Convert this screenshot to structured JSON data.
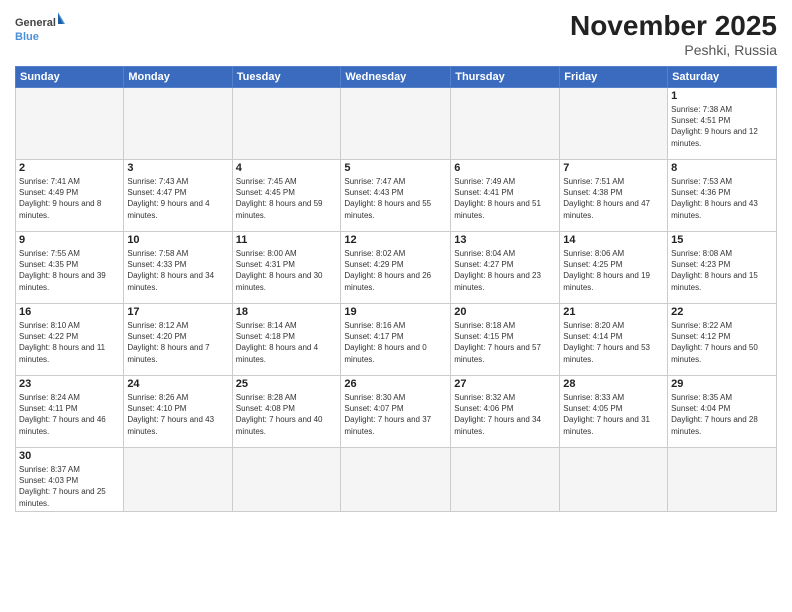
{
  "header": {
    "logo_general": "General",
    "logo_blue": "Blue",
    "month_title": "November 2025",
    "location": "Peshki, Russia"
  },
  "weekdays": [
    "Sunday",
    "Monday",
    "Tuesday",
    "Wednesday",
    "Thursday",
    "Friday",
    "Saturday"
  ],
  "weeks": [
    [
      {
        "day": "",
        "info": ""
      },
      {
        "day": "",
        "info": ""
      },
      {
        "day": "",
        "info": ""
      },
      {
        "day": "",
        "info": ""
      },
      {
        "day": "",
        "info": ""
      },
      {
        "day": "",
        "info": ""
      },
      {
        "day": "1",
        "info": "Sunrise: 7:38 AM\nSunset: 4:51 PM\nDaylight: 9 hours and 12 minutes."
      }
    ],
    [
      {
        "day": "2",
        "info": "Sunrise: 7:41 AM\nSunset: 4:49 PM\nDaylight: 9 hours and 8 minutes."
      },
      {
        "day": "3",
        "info": "Sunrise: 7:43 AM\nSunset: 4:47 PM\nDaylight: 9 hours and 4 minutes."
      },
      {
        "day": "4",
        "info": "Sunrise: 7:45 AM\nSunset: 4:45 PM\nDaylight: 8 hours and 59 minutes."
      },
      {
        "day": "5",
        "info": "Sunrise: 7:47 AM\nSunset: 4:43 PM\nDaylight: 8 hours and 55 minutes."
      },
      {
        "day": "6",
        "info": "Sunrise: 7:49 AM\nSunset: 4:41 PM\nDaylight: 8 hours and 51 minutes."
      },
      {
        "day": "7",
        "info": "Sunrise: 7:51 AM\nSunset: 4:38 PM\nDaylight: 8 hours and 47 minutes."
      },
      {
        "day": "8",
        "info": "Sunrise: 7:53 AM\nSunset: 4:36 PM\nDaylight: 8 hours and 43 minutes."
      }
    ],
    [
      {
        "day": "9",
        "info": "Sunrise: 7:55 AM\nSunset: 4:35 PM\nDaylight: 8 hours and 39 minutes."
      },
      {
        "day": "10",
        "info": "Sunrise: 7:58 AM\nSunset: 4:33 PM\nDaylight: 8 hours and 34 minutes."
      },
      {
        "day": "11",
        "info": "Sunrise: 8:00 AM\nSunset: 4:31 PM\nDaylight: 8 hours and 30 minutes."
      },
      {
        "day": "12",
        "info": "Sunrise: 8:02 AM\nSunset: 4:29 PM\nDaylight: 8 hours and 26 minutes."
      },
      {
        "day": "13",
        "info": "Sunrise: 8:04 AM\nSunset: 4:27 PM\nDaylight: 8 hours and 23 minutes."
      },
      {
        "day": "14",
        "info": "Sunrise: 8:06 AM\nSunset: 4:25 PM\nDaylight: 8 hours and 19 minutes."
      },
      {
        "day": "15",
        "info": "Sunrise: 8:08 AM\nSunset: 4:23 PM\nDaylight: 8 hours and 15 minutes."
      }
    ],
    [
      {
        "day": "16",
        "info": "Sunrise: 8:10 AM\nSunset: 4:22 PM\nDaylight: 8 hours and 11 minutes."
      },
      {
        "day": "17",
        "info": "Sunrise: 8:12 AM\nSunset: 4:20 PM\nDaylight: 8 hours and 7 minutes."
      },
      {
        "day": "18",
        "info": "Sunrise: 8:14 AM\nSunset: 4:18 PM\nDaylight: 8 hours and 4 minutes."
      },
      {
        "day": "19",
        "info": "Sunrise: 8:16 AM\nSunset: 4:17 PM\nDaylight: 8 hours and 0 minutes."
      },
      {
        "day": "20",
        "info": "Sunrise: 8:18 AM\nSunset: 4:15 PM\nDaylight: 7 hours and 57 minutes."
      },
      {
        "day": "21",
        "info": "Sunrise: 8:20 AM\nSunset: 4:14 PM\nDaylight: 7 hours and 53 minutes."
      },
      {
        "day": "22",
        "info": "Sunrise: 8:22 AM\nSunset: 4:12 PM\nDaylight: 7 hours and 50 minutes."
      }
    ],
    [
      {
        "day": "23",
        "info": "Sunrise: 8:24 AM\nSunset: 4:11 PM\nDaylight: 7 hours and 46 minutes."
      },
      {
        "day": "24",
        "info": "Sunrise: 8:26 AM\nSunset: 4:10 PM\nDaylight: 7 hours and 43 minutes."
      },
      {
        "day": "25",
        "info": "Sunrise: 8:28 AM\nSunset: 4:08 PM\nDaylight: 7 hours and 40 minutes."
      },
      {
        "day": "26",
        "info": "Sunrise: 8:30 AM\nSunset: 4:07 PM\nDaylight: 7 hours and 37 minutes."
      },
      {
        "day": "27",
        "info": "Sunrise: 8:32 AM\nSunset: 4:06 PM\nDaylight: 7 hours and 34 minutes."
      },
      {
        "day": "28",
        "info": "Sunrise: 8:33 AM\nSunset: 4:05 PM\nDaylight: 7 hours and 31 minutes."
      },
      {
        "day": "29",
        "info": "Sunrise: 8:35 AM\nSunset: 4:04 PM\nDaylight: 7 hours and 28 minutes."
      }
    ],
    [
      {
        "day": "30",
        "info": "Sunrise: 8:37 AM\nSunset: 4:03 PM\nDaylight: 7 hours and 25 minutes."
      },
      {
        "day": "",
        "info": ""
      },
      {
        "day": "",
        "info": ""
      },
      {
        "day": "",
        "info": ""
      },
      {
        "day": "",
        "info": ""
      },
      {
        "day": "",
        "info": ""
      },
      {
        "day": "",
        "info": ""
      }
    ]
  ]
}
